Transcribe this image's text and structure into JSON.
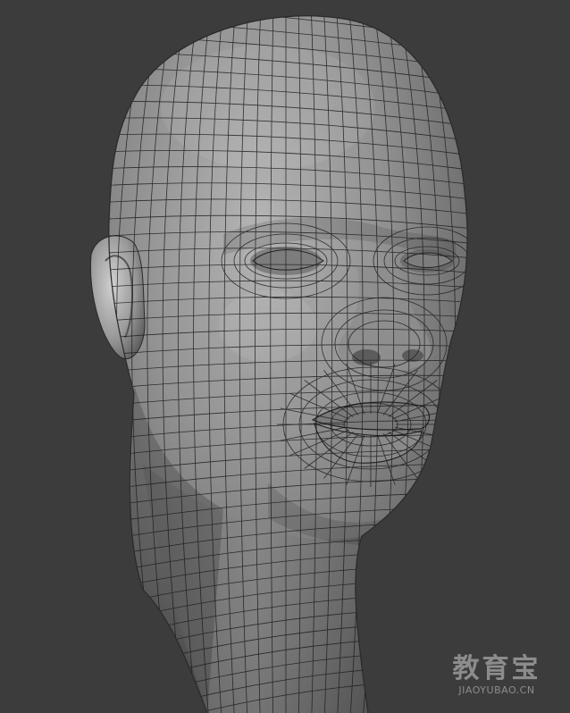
{
  "scene": {
    "subject": "head-mesh",
    "background_color": "#3c3c3c",
    "mesh_color": "#8c8c8c",
    "wire_color": "#1a1a1a"
  },
  "watermark": {
    "title": "教育宝",
    "url": "JIAOYUBAO.CN"
  }
}
